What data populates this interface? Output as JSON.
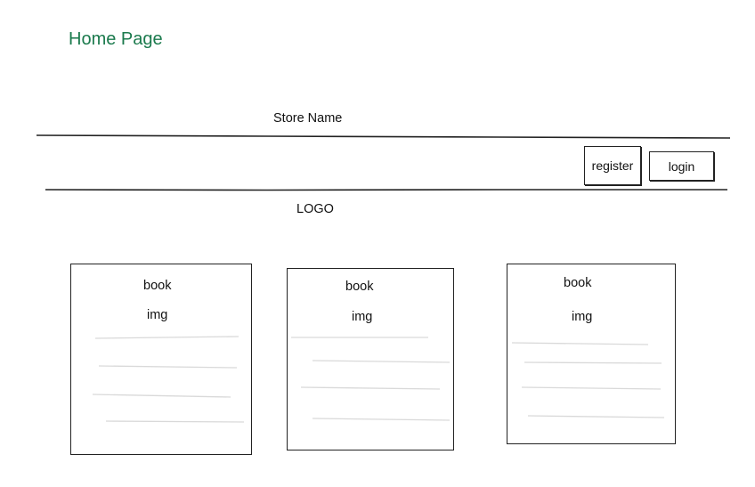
{
  "page": {
    "title": "Home Page"
  },
  "header": {
    "store_name": "Store Name",
    "register_label": "register",
    "login_label": "login",
    "logo_text": "LOGO"
  },
  "books": [
    {
      "title": "book",
      "image": "img"
    },
    {
      "title": "book",
      "image": "img"
    },
    {
      "title": "book",
      "image": "img"
    }
  ],
  "colors": {
    "title": "#1b7a4d",
    "stroke": "#222222",
    "placeholder_line": "#d9d9d9"
  }
}
